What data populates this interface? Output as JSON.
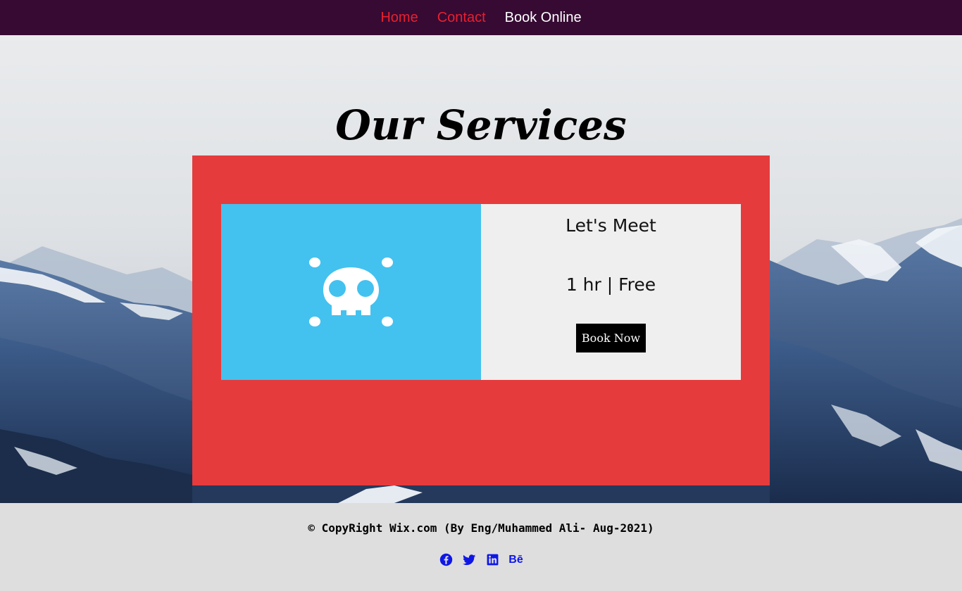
{
  "nav": {
    "items": [
      {
        "label": "Home",
        "color": "#e8202f"
      },
      {
        "label": "Contact",
        "color": "#e8202f"
      },
      {
        "label": "Book Online",
        "color": "#ffffff"
      }
    ],
    "background": "#360a33"
  },
  "main": {
    "title": "Our Services",
    "panel_color": "#e63b3c",
    "service": {
      "name": "Let's Meet",
      "meta": "1 hr | Free",
      "button_label": "Book Now",
      "image_color": "#43c2ef",
      "image_icon": "skull-icon"
    }
  },
  "footer": {
    "copyright": "© CopyRight Wix.com (By Eng/Muhammed Ali- Aug-2021)",
    "social": [
      {
        "icon": "facebook-icon"
      },
      {
        "icon": "twitter-icon"
      },
      {
        "icon": "linkedin-icon"
      },
      {
        "icon": "behance-icon",
        "label": "Bē"
      }
    ],
    "link_color": "#0f17e6"
  }
}
